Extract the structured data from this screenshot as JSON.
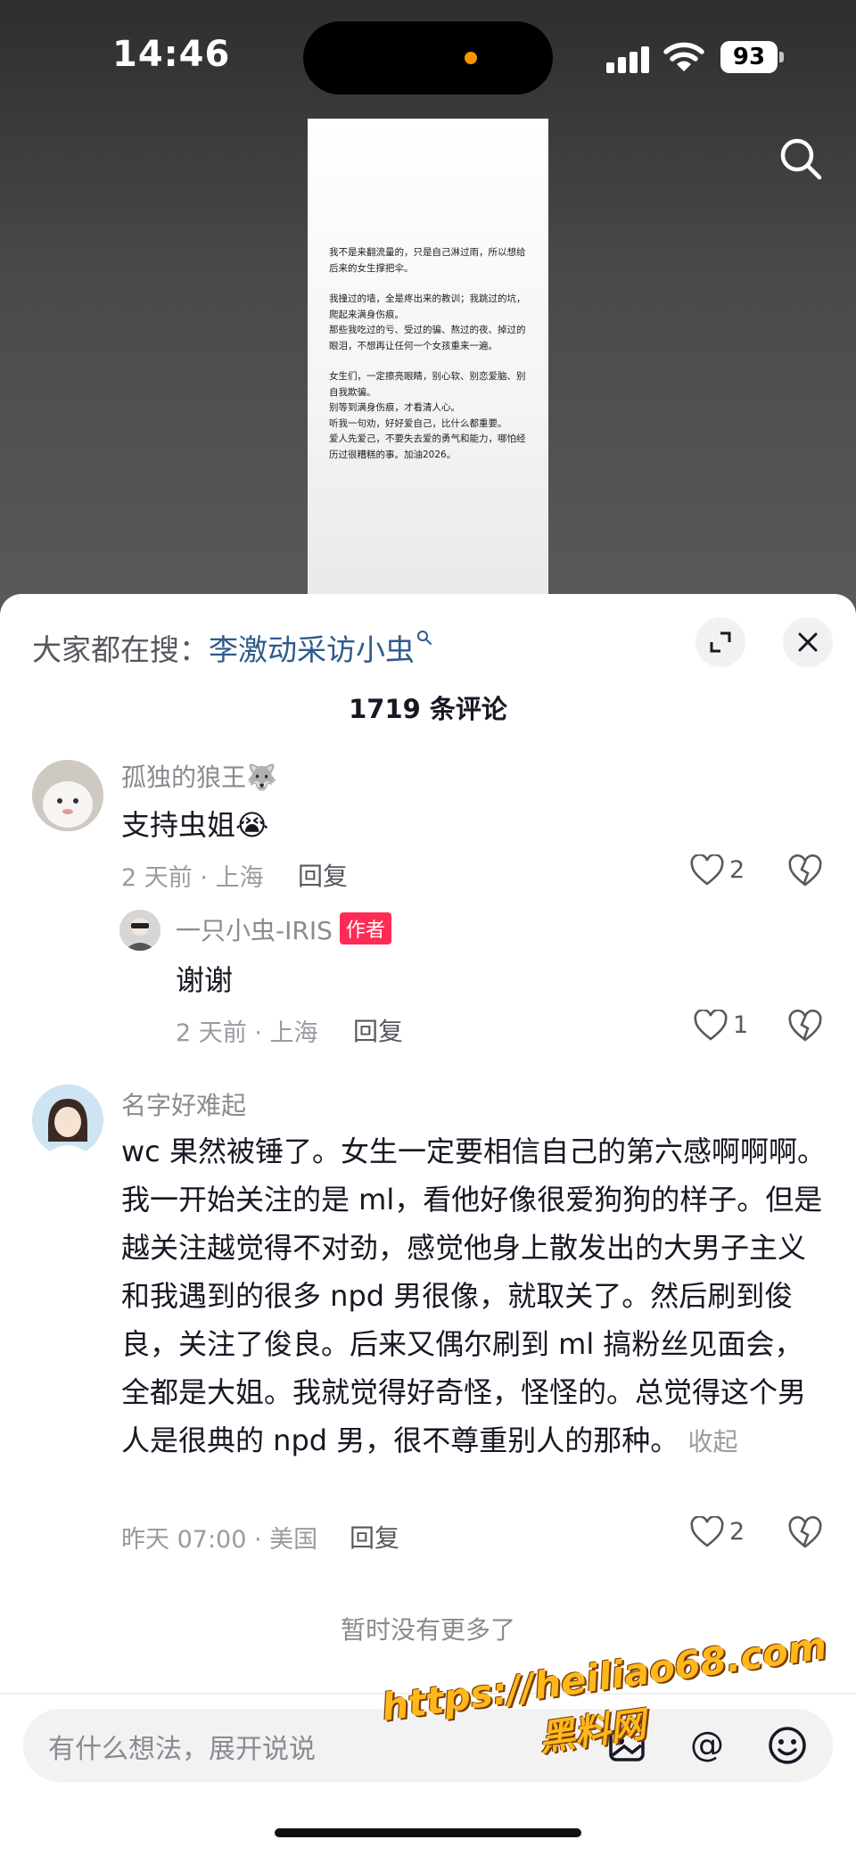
{
  "status_bar": {
    "time": "14:46",
    "battery": "93"
  },
  "note": {
    "paragraphs": [
      "我不是来翻流量的，只是自己淋过雨，所以想给后来的女生撑把伞。",
      "我撞过的墙，全是疼出来的教训；我跳过的坑，爬起来满身伤痕。\n那些我吃过的亏、受过的骗、熬过的夜、掉过的眼泪，不想再让任何一个女孩重来一遍。",
      "女生们，一定擦亮眼睛，别心软、别恋爱脑、别自我欺骗。\n别等到满身伤痕，才看清人心。\n听我一句劝，好好爱自己，比什么都重要。\n爱人先爱己，不要失去爱的勇气和能力，哪怕经历过很糟糕的事。加油2026。"
    ]
  },
  "hot_search": {
    "label": "大家都在搜：",
    "keyword": "李激动采访小虫"
  },
  "comments_header": {
    "count_label": "1719 条评论"
  },
  "comments": [
    {
      "username": "孤独的狼王🐺",
      "text": "支持虫姐😭",
      "meta": "2 天前 · 上海",
      "reply_label": "回复",
      "likes": "2"
    },
    {
      "username": "一只小虫-IRIS",
      "badge": "作者",
      "text": "谢谢",
      "meta": "2 天前 · 上海",
      "reply_label": "回复",
      "likes": "1"
    },
    {
      "username": "名字好难起",
      "text": "wc 果然被锤了。女生一定要相信自己的第六感啊啊啊。我一开始关注的是 ml，看他好像很爱狗狗的样子。但是越关注越觉得不对劲，感觉他身上散发出的大男子主义和我遇到的很多 npd 男很像，就取关了。然后刷到俊良，关注了俊良。后来又偶尔刷到 ml 搞粉丝见面会，全都是大姐。我就觉得好奇怪，怪怪的。总觉得这个男人是很典的 npd 男，很不尊重别人的那种。",
      "collapse_label": "收起",
      "meta": "昨天 07:00 · 美国",
      "reply_label": "回复",
      "likes": "2"
    }
  ],
  "no_more": "暂时没有更多了",
  "input": {
    "placeholder": "有什么想法，展开说说"
  },
  "watermark": {
    "url": "https://heiliao68.com",
    "name": "黑料网"
  },
  "colors": {
    "accent_red": "#fe2c55",
    "link_blue": "#2f5a8d"
  }
}
